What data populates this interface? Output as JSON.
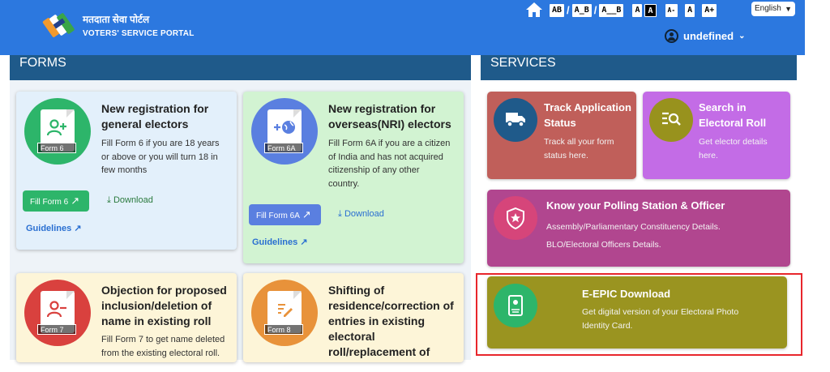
{
  "header": {
    "logo_hindi": "मतदाता सेवा पोर्टल",
    "logo_english": "VOTERS' SERVICE PORTAL",
    "accessibility": [
      "AB",
      "A_B",
      "A__B",
      "A",
      "A",
      "A-",
      "A",
      "A+"
    ],
    "separators": [
      "/",
      "/"
    ],
    "language": "English",
    "user": "undefined",
    "colors": {
      "bar": "#2c78df"
    }
  },
  "forms": {
    "heading": "FORMS",
    "cards": [
      {
        "tag": "Form 6",
        "title_lines": [
          "New registration for",
          "general electors"
        ],
        "desc_lines": [
          "Fill Form 6 if you are 18 years",
          "or above or you will turn 18 in",
          "few months"
        ],
        "fill_label": "Fill Form 6",
        "download_label": "Download",
        "guidelines_label": "Guidelines",
        "icon": "add-user-icon",
        "color": "#2db56a"
      },
      {
        "tag": "Form 6A",
        "title_lines": [
          "New registration for",
          "overseas(NRI) electors"
        ],
        "desc_lines": [
          "Fill Form 6A if you are a citizen",
          "of India and has not acquired",
          "citizenship of any other",
          "country."
        ],
        "fill_label": "Fill Form 6A",
        "download_label": "Download",
        "guidelines_label": "Guidelines",
        "icon": "globe-add-icon",
        "color": "#5a7fe0"
      },
      {
        "tag": "Form 7",
        "title_lines": [
          "Objection for proposed",
          "inclusion/deletion of",
          "name in existing roll"
        ],
        "desc_lines": [
          "Fill Form 7 to get name deleted",
          "from the existing electoral roll."
        ],
        "icon": "remove-user-icon",
        "color": "#d9413e"
      },
      {
        "tag": "Form 8",
        "title_lines": [
          "Shifting of",
          "residence/correction of",
          "entries in existing",
          "electoral",
          "roll/replacement of"
        ],
        "icon": "edit-doc-icon",
        "color": "#e8923a"
      }
    ]
  },
  "services": {
    "heading": "SERVICES",
    "cards": [
      {
        "title_lines": [
          "Track Application",
          "Status"
        ],
        "desc_lines": [
          "Track all your form",
          "status here."
        ],
        "icon": "truck-icon"
      },
      {
        "title_lines": [
          "Search in",
          "Electoral Roll"
        ],
        "desc_lines": [
          "Get elector details",
          "here."
        ],
        "icon": "search-list-icon"
      },
      {
        "title_lines": [
          "Know your Polling Station & Officer"
        ],
        "desc_lines": [
          "Assembly/Parliamentary Constituency Details.",
          "BLO/Electoral Officers Details."
        ],
        "icon": "shield-star-icon"
      },
      {
        "title_lines": [
          "E-EPIC Download"
        ],
        "desc_lines": [
          "Get digital version of your Electoral Photo",
          "Identity Card."
        ],
        "icon": "id-card-icon"
      }
    ]
  }
}
